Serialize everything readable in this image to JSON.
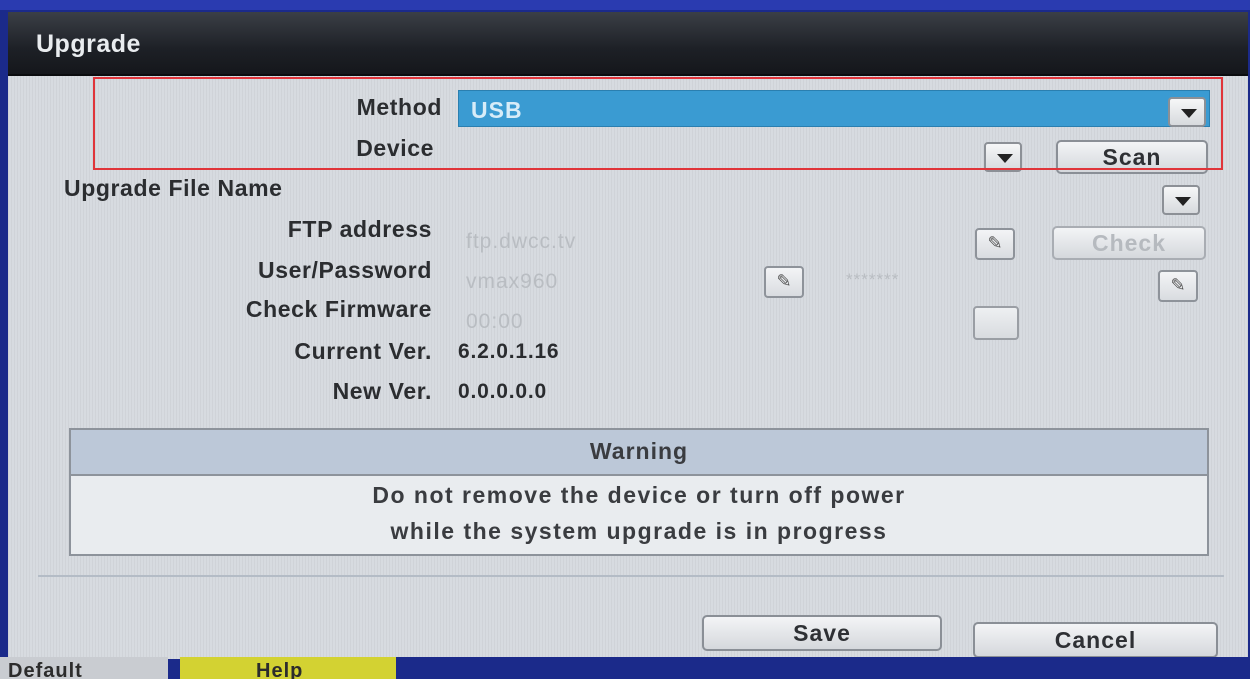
{
  "title": "Upgrade",
  "labels": {
    "method": "Method",
    "device": "Device",
    "upgrade_file_name": "Upgrade File Name",
    "ftp_address": "FTP address",
    "user_password": "User/Password",
    "check_firmware": "Check Firmware",
    "current_ver": "Current Ver.",
    "new_ver": "New Ver."
  },
  "values": {
    "method": "USB",
    "ftp_address": "ftp.dwcc.tv",
    "user": "vmax960",
    "password": "*******",
    "check_firmware": "00:00",
    "current_ver": "6.2.0.1.16",
    "new_ver": "0.0.0.0.0"
  },
  "buttons": {
    "scan": "Scan",
    "check": "Check",
    "save": "Save",
    "cancel": "Cancel"
  },
  "warning": {
    "title": "Warning",
    "line1": "Do not remove the device or turn off power",
    "line2": "while the system upgrade is in progress"
  },
  "bottom_tabs": {
    "default": "Default",
    "help": "Help"
  },
  "icons": {
    "dropdown": "chevron-down-icon",
    "edit": "pencil-icon"
  },
  "colors": {
    "method_selected": "#3a9bd2",
    "highlight_box": "#e0353a",
    "help_tab": "#d3d232"
  }
}
